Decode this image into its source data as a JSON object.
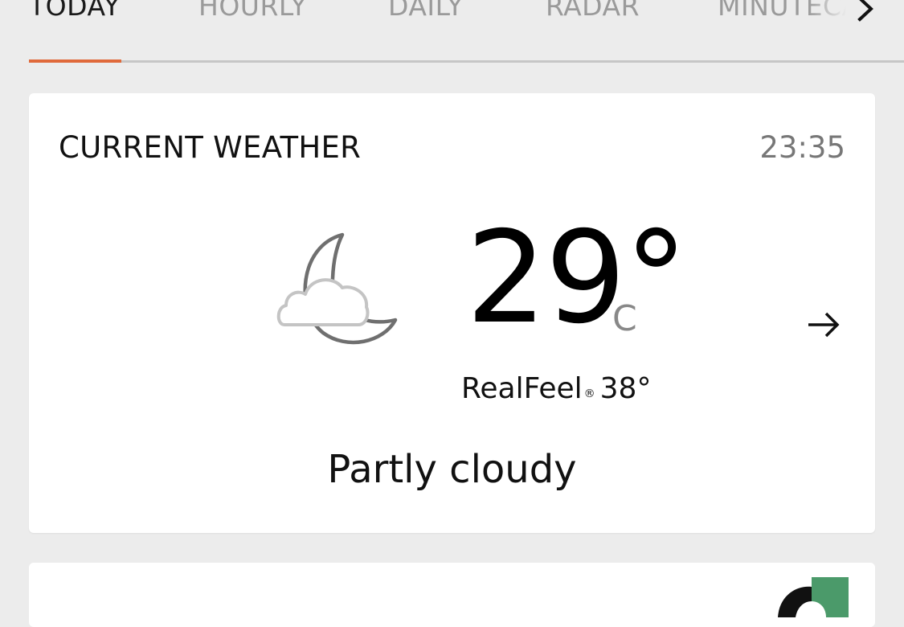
{
  "tabs": [
    {
      "label": "TODAY",
      "active": true
    },
    {
      "label": "HOURLY",
      "active": false
    },
    {
      "label": "DAILY",
      "active": false
    },
    {
      "label": "RADAR",
      "active": false
    },
    {
      "label": "MINUTECAST",
      "active": false
    }
  ],
  "tab_scroll_icon": "chevron-right-icon",
  "accent_color": "#e06a3b",
  "current_weather": {
    "title": "CURRENT WEATHER",
    "time": "23:35",
    "icon": "moon-cloud-icon",
    "temperature": "29°",
    "unit": "C",
    "realfeel_label": "RealFeel",
    "realfeel_mark": "®",
    "realfeel_value": "38°",
    "phrase": "Partly cloudy",
    "details_icon": "arrow-right-icon"
  },
  "next_card": {
    "logo_icon": "partner-logo-icon"
  }
}
